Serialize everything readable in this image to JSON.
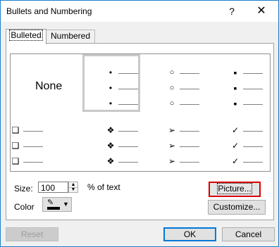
{
  "window": {
    "title": "Bullets and Numbering",
    "help": "?",
    "close": "✕"
  },
  "tabs": [
    {
      "label": "Bulleted",
      "active": true
    },
    {
      "label": "Numbered",
      "active": false
    }
  ],
  "gallery": {
    "none_label": "None",
    "selected_index": 1,
    "styles": [
      {
        "name": "none"
      },
      {
        "name": "filled-round",
        "symbol": "•"
      },
      {
        "name": "hollow-round",
        "symbol": "○"
      },
      {
        "name": "filled-square",
        "symbol": "▪"
      },
      {
        "name": "hollow-square",
        "symbol": "❑"
      },
      {
        "name": "four-diamond",
        "symbol": "❖"
      },
      {
        "name": "arrowhead",
        "symbol": "➢"
      },
      {
        "name": "checkmark",
        "symbol": "✓"
      }
    ]
  },
  "size": {
    "label": "Size:",
    "value": "100",
    "unit": "% of text"
  },
  "color": {
    "label": "Color",
    "swatch": "#000000"
  },
  "buttons": {
    "picture": "Picture...",
    "customize": "Customize...",
    "reset": "Reset",
    "ok": "OK",
    "cancel": "Cancel"
  },
  "colors": {
    "accent": "#0078d7",
    "focus": "#d80000"
  }
}
